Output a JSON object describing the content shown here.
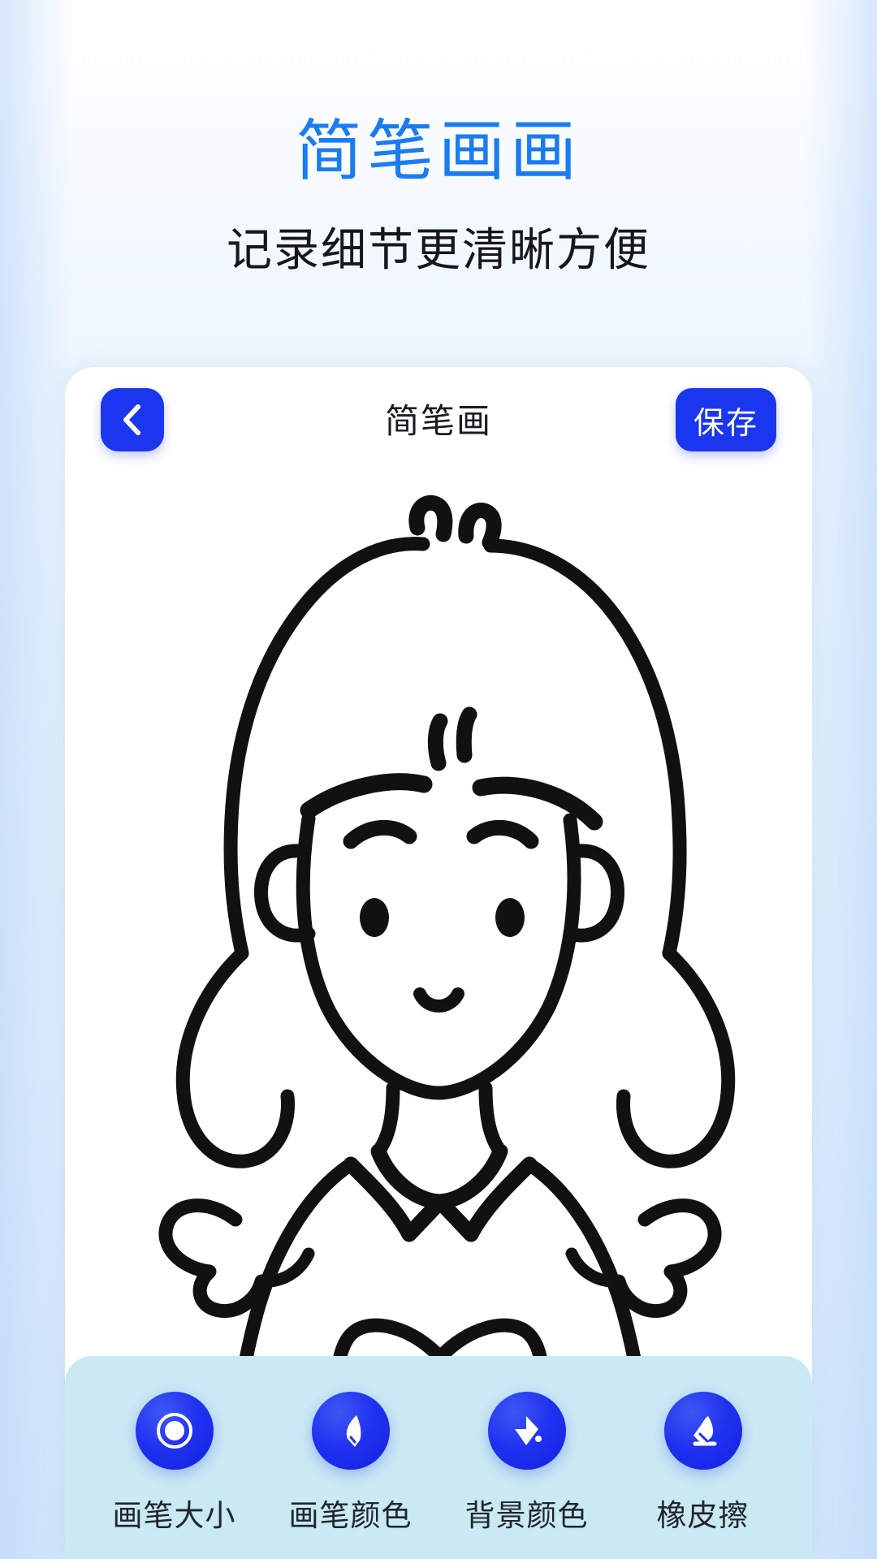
{
  "promo": {
    "title": "简笔画画",
    "subtitle": "记录细节更清晰方便",
    "title_color": "#1a7cf0",
    "subtitle_color": "#15171c"
  },
  "app": {
    "header": {
      "back_icon": "chevron-left-icon",
      "title": "简笔画",
      "save_label": "保存",
      "accent_color": "#1a36ef"
    },
    "canvas": {
      "background_color": "#ffffff",
      "stroke_color": "#111111",
      "drawing_description": "girl-line-drawing"
    },
    "toolbar": {
      "background_color": "#c9e9f3",
      "tools": [
        {
          "label": "画笔大小",
          "icon": "brush-size-icon"
        },
        {
          "label": "画笔颜色",
          "icon": "pen-color-icon"
        },
        {
          "label": "背景颜色",
          "icon": "paint-bucket-icon"
        },
        {
          "label": "橡皮擦",
          "icon": "eraser-icon"
        }
      ]
    }
  }
}
